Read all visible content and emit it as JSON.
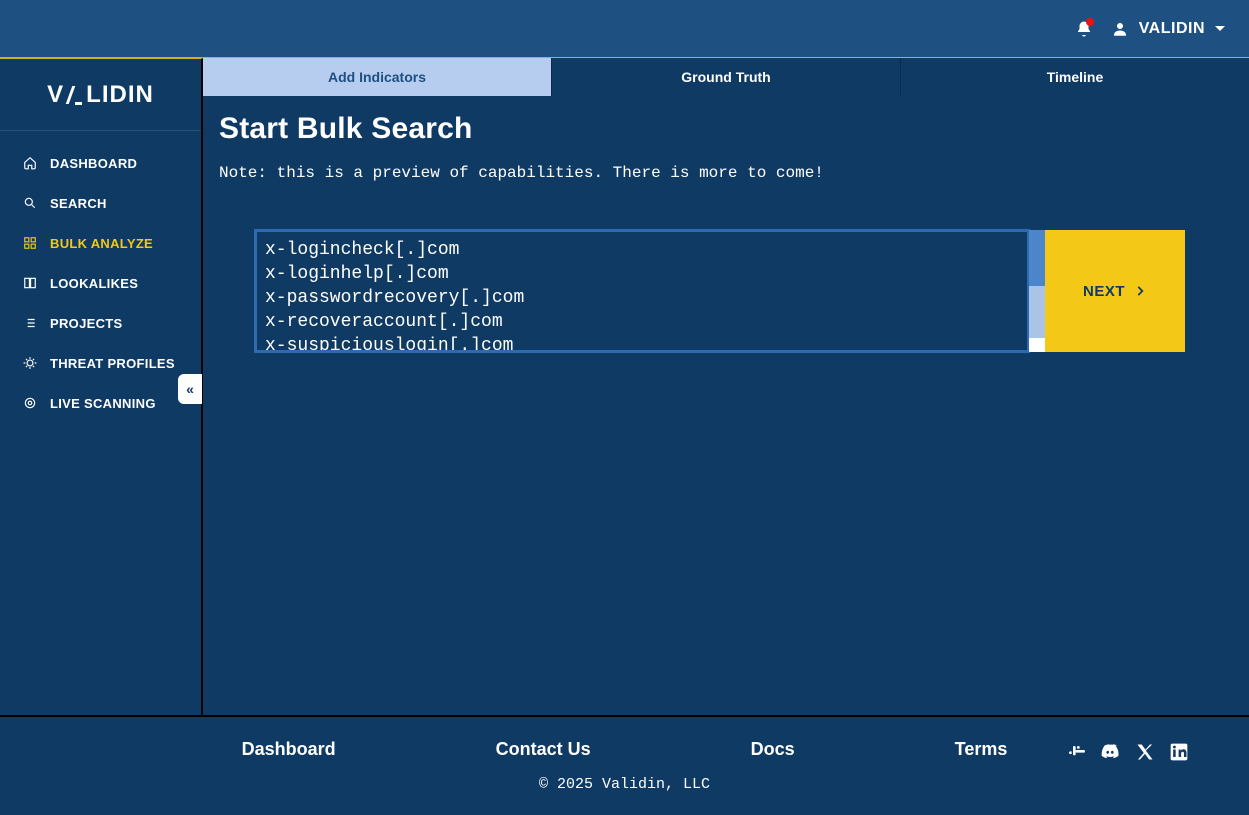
{
  "header": {
    "user_label": "VALIDIN"
  },
  "brand": "VALIDIN",
  "sidebar": {
    "items": [
      {
        "label": "DASHBOARD",
        "icon": "home"
      },
      {
        "label": "SEARCH",
        "icon": "search"
      },
      {
        "label": "BULK ANALYZE",
        "icon": "grid",
        "active": true
      },
      {
        "label": "LOOKALIKES",
        "icon": "compare"
      },
      {
        "label": "PROJECTS",
        "icon": "list"
      },
      {
        "label": "THREAT PROFILES",
        "icon": "bug"
      },
      {
        "label": "LIVE SCANNING",
        "icon": "target"
      }
    ]
  },
  "tabs": [
    {
      "label": "Add Indicators",
      "active": true
    },
    {
      "label": "Ground Truth"
    },
    {
      "label": "Timeline"
    }
  ],
  "page": {
    "title": "Start Bulk Search",
    "note": "Note: this is a preview of capabilities. There is more to come!",
    "textarea_value": "x-logincheck[.]com\nx-loginhelp[.]com\nx-passwordrecovery[.]com\nx-recoveraccount[.]com\nx-suspiciouslogin[.]com",
    "next_label": "NEXT"
  },
  "footer": {
    "links": [
      "Dashboard",
      "Contact Us",
      "Docs",
      "Terms"
    ],
    "copyright": "© 2025 Validin, LLC"
  }
}
